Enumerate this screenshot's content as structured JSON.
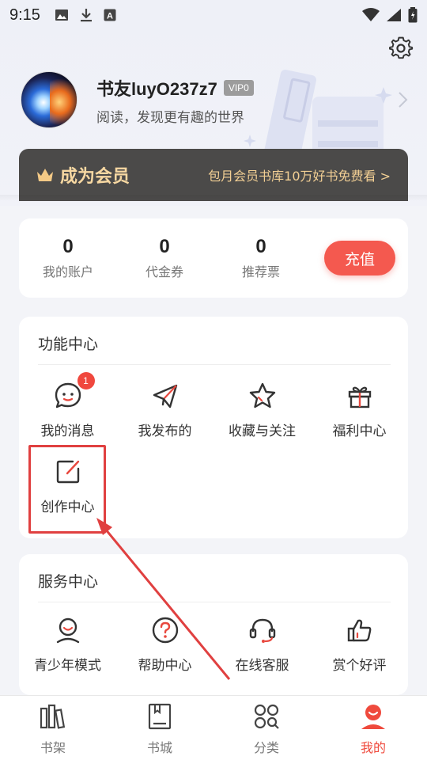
{
  "status_bar": {
    "time": "9:15",
    "left_icons": [
      "image-icon",
      "download-icon",
      "a-font-icon"
    ],
    "right_icons": [
      "wifi-icon",
      "signal-icon",
      "battery-icon"
    ]
  },
  "profile": {
    "username": "书友luyO237z7",
    "vip_badge": "VIP0",
    "tagline": "阅读，发现更有趣的世界"
  },
  "member_banner": {
    "title": "成为会员",
    "promo": "包月会员书库10万好书免费看 >"
  },
  "stats": {
    "items": [
      {
        "value": "0",
        "label": "我的账户"
      },
      {
        "value": "0",
        "label": "代金券"
      },
      {
        "value": "0",
        "label": "推荐票"
      }
    ],
    "recharge_label": "充值"
  },
  "function_center": {
    "title": "功能中心",
    "items": [
      {
        "label": "我的消息",
        "icon": "message-icon",
        "badge": "1"
      },
      {
        "label": "我发布的",
        "icon": "send-icon"
      },
      {
        "label": "收藏与关注",
        "icon": "star-icon"
      },
      {
        "label": "福利中心",
        "icon": "gift-icon"
      },
      {
        "label": "创作中心",
        "icon": "edit-icon"
      }
    ]
  },
  "service_center": {
    "title": "服务中心",
    "items": [
      {
        "label": "青少年模式",
        "icon": "teen-icon"
      },
      {
        "label": "帮助中心",
        "icon": "help-icon"
      },
      {
        "label": "在线客服",
        "icon": "headset-icon"
      },
      {
        "label": "赏个好评",
        "icon": "thumbs-up-icon"
      }
    ]
  },
  "tab_bar": {
    "tabs": [
      {
        "label": "书架",
        "icon": "bookshelf-icon",
        "active": false
      },
      {
        "label": "书城",
        "icon": "bookstore-icon",
        "active": false
      },
      {
        "label": "分类",
        "icon": "category-icon",
        "active": false
      },
      {
        "label": "我的",
        "icon": "profile-icon",
        "active": true
      }
    ]
  },
  "colors": {
    "accent": "#f4594f",
    "member_gold": "#f2cf94",
    "banner_bg": "#4b4a49",
    "annotation_red": "#e04040"
  }
}
